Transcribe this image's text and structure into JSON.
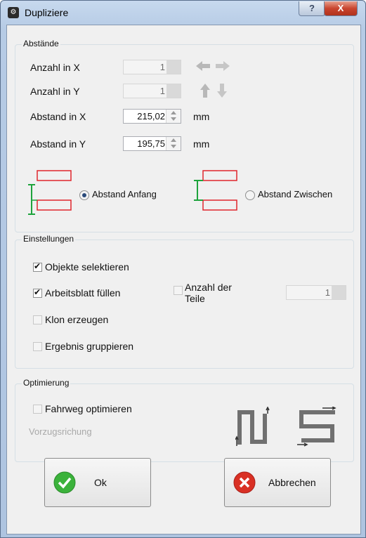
{
  "window": {
    "title": "Dupliziere",
    "help_glyph": "?",
    "close_glyph": "X"
  },
  "abstaende": {
    "title": "Abstände",
    "anzahl_x": {
      "label": "Anzahl in X",
      "value": "1"
    },
    "anzahl_y": {
      "label": "Anzahl in Y",
      "value": "1"
    },
    "abstand_x": {
      "label": "Abstand in X",
      "value": "215,02",
      "unit": "mm"
    },
    "abstand_y": {
      "label": "Abstand in Y",
      "value": "195,75",
      "unit": "mm"
    },
    "radio_anfang": {
      "label": "Abstand Anfang",
      "selected": true
    },
    "radio_zwischen": {
      "label": "Abstand Zwischen",
      "selected": false
    }
  },
  "einstellungen": {
    "title": "Einstellungen",
    "objekte": {
      "label": "Objekte selektieren",
      "checked": true
    },
    "arbeitsblatt": {
      "label": "Arbeitsblatt füllen",
      "checked": true
    },
    "anzahl_teile_line1": "Anzahl der",
    "anzahl_teile_line2": "Teile",
    "anzahl_teile_value": "1",
    "klon": {
      "label": "Klon erzeugen",
      "checked": false
    },
    "gruppieren": {
      "label": "Ergebnis gruppieren",
      "checked": false
    }
  },
  "optimierung": {
    "title": "Optimierung",
    "fahrweg": {
      "label": "Fahrweg optimieren",
      "checked": false
    },
    "vorzugsrichtung": "Vorzugsrichung"
  },
  "buttons": {
    "ok": "Ok",
    "abbrechen": "Abbrechen"
  },
  "colors": {
    "diagram_red": "#e0262c",
    "diagram_green": "#1ea33c",
    "ok_green": "#3bb23b",
    "cancel_red": "#d93024"
  }
}
